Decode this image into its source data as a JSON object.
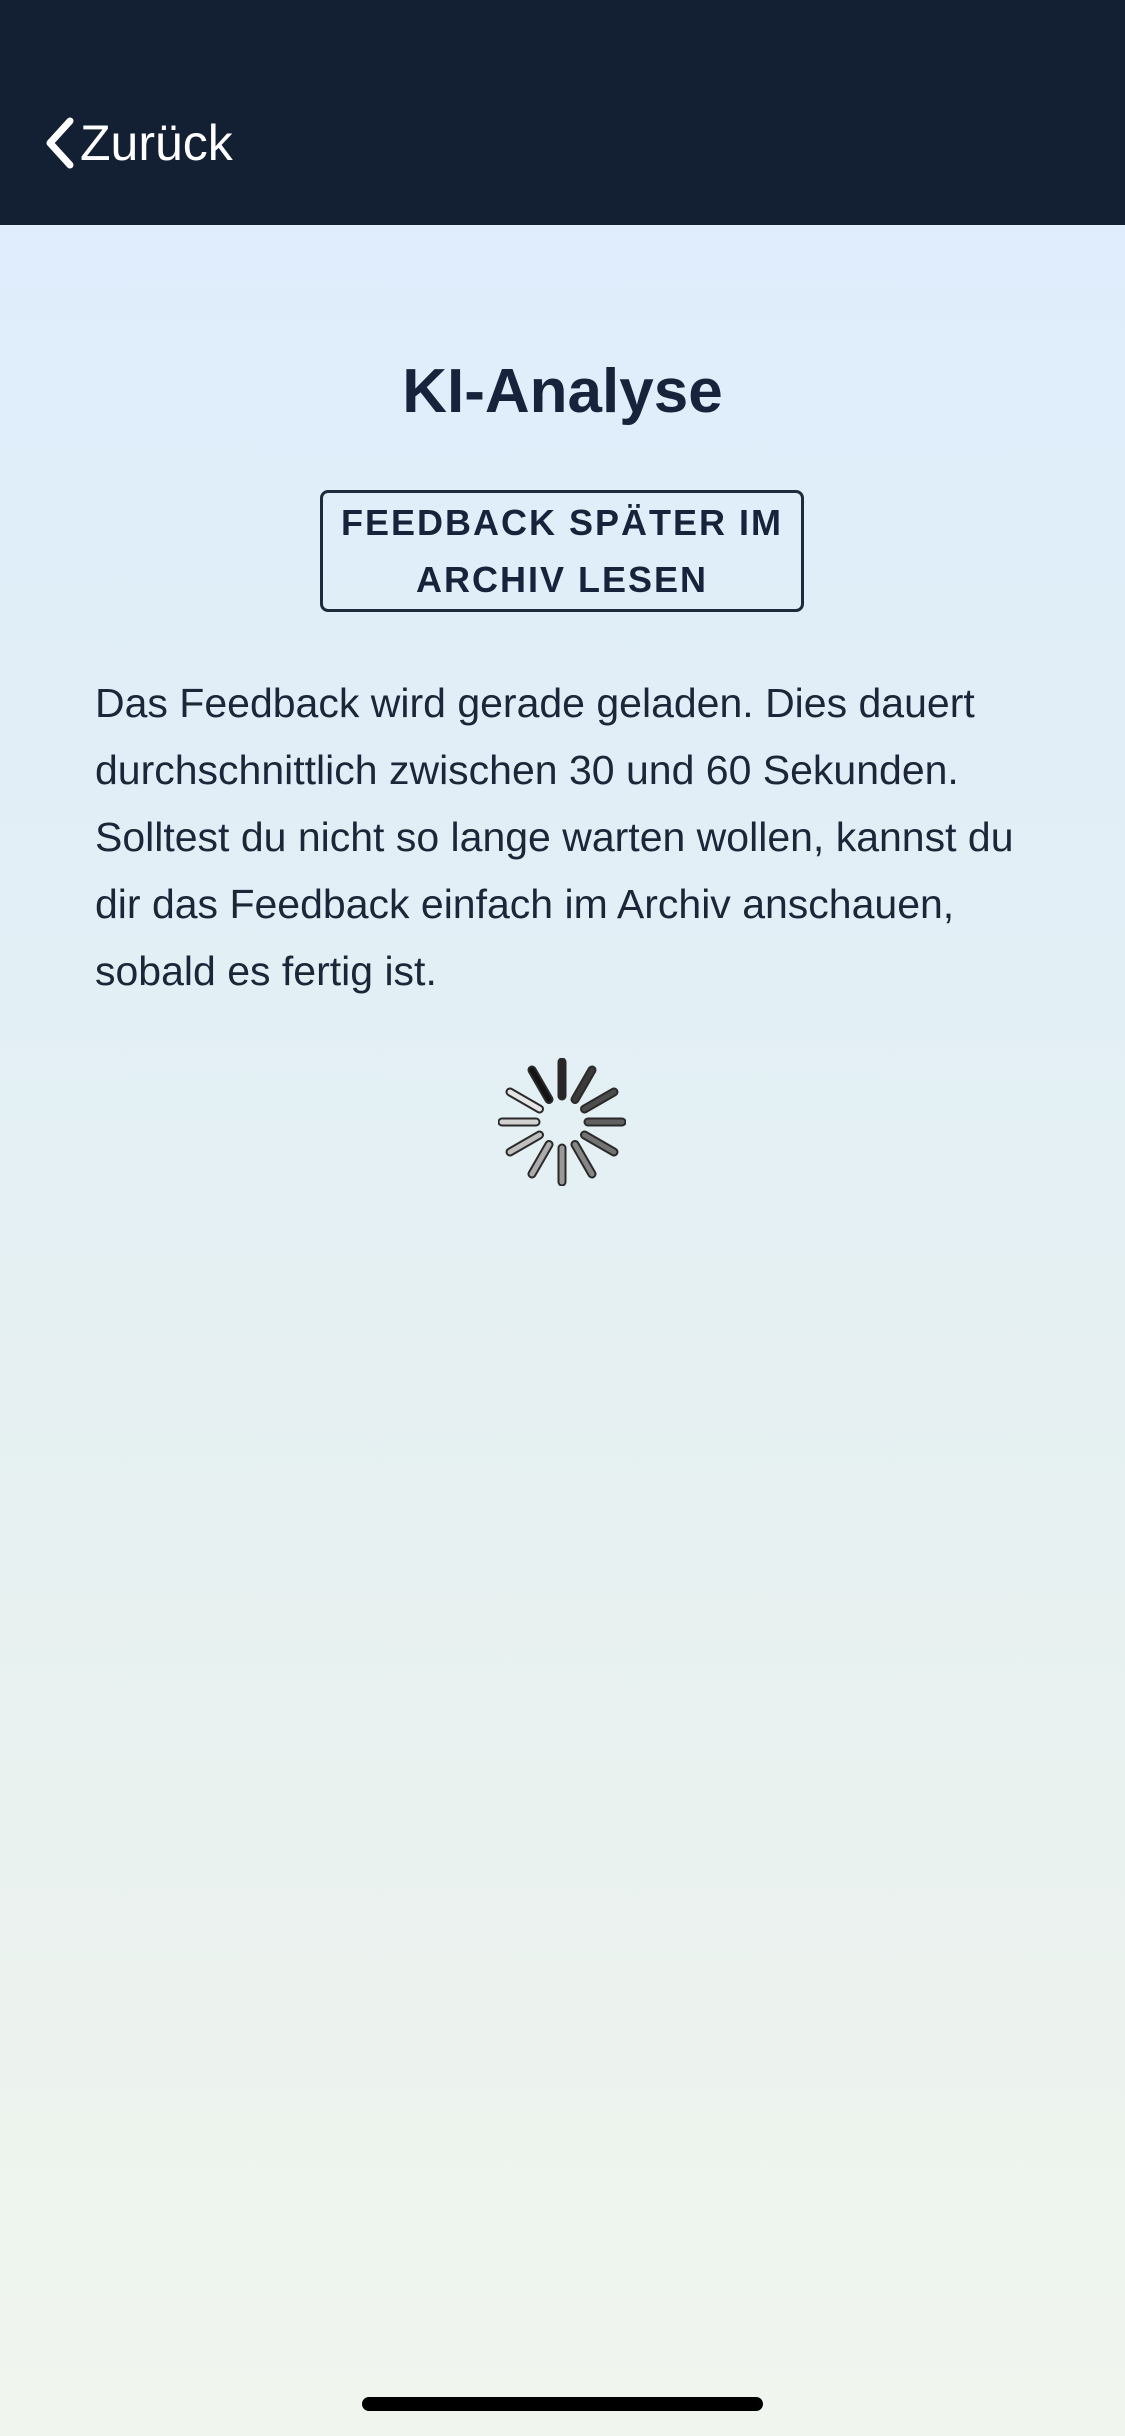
{
  "header": {
    "back_label": "Zurück",
    "background": "#131f33"
  },
  "main": {
    "title": "KI-Analyse",
    "archive_button_label": "FEEDBACK SPÄTER IM ARCHIV LESEN",
    "info_text": "Das Feedback wird gerade geladen. Dies dauert durchschnittlich zwischen 30 und 60 Sekunden. Solltest du nicht so lange warten wollen, kannst du dir das Feedback einfach im Archiv anschauen, sobald es fertig ist."
  },
  "icons": {
    "back": "chevron-left-icon",
    "loading": "loading-spinner-icon"
  },
  "colors": {
    "text": "#17233a",
    "background_top": "#deecfe",
    "background_bottom": "#f0f5ee"
  }
}
